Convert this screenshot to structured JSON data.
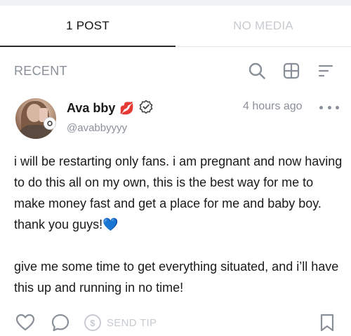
{
  "tabs": {
    "posts_label": "1 POST",
    "media_label": "NO MEDIA"
  },
  "toolbar": {
    "section_label": "RECENT",
    "icons": [
      "search-icon",
      "grid-icon",
      "sort-icon"
    ]
  },
  "post": {
    "author_name": "Ava bby",
    "author_emoji": "💋",
    "verified_icon": "verified-icon",
    "handle": "@avabbyyyy",
    "timestamp": "4 hours ago",
    "paragraph_1": "i will be restarting only fans. i am pregnant and now having to do this all on my own, this is the best way for me to make money fast and get a place for me and baby boy. thank you guys!💙",
    "paragraph_2": "give me some time to get everything situated, and i’ll have this up and running in no time!"
  },
  "actions": {
    "send_tip_label": "SEND TIP",
    "icons": [
      "heart-icon",
      "comment-icon",
      "dollar-icon",
      "bookmark-icon"
    ]
  },
  "colors": {
    "muted": "#8a9099",
    "disabled": "#c7cbd0",
    "heart_emoji": "#3d7be0"
  }
}
